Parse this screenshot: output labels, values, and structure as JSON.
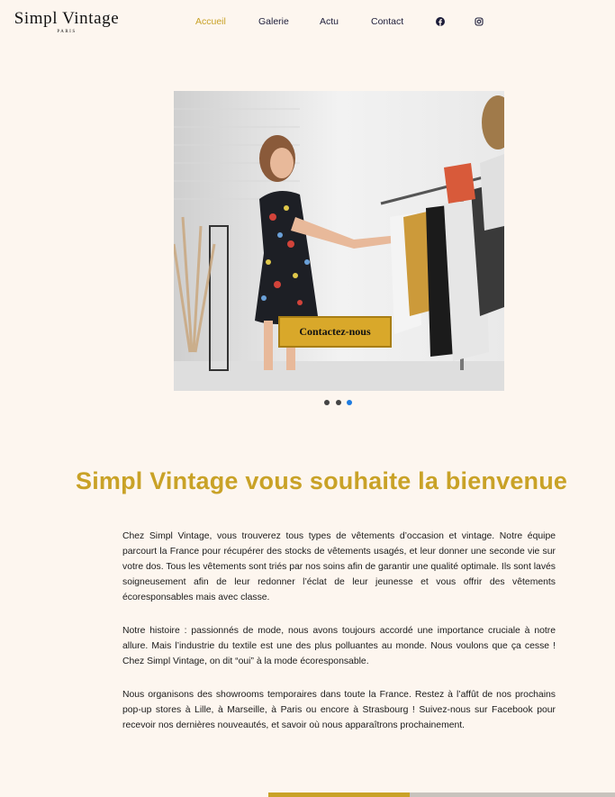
{
  "brand": {
    "name": "Simpl Vintage",
    "subtitle": "PARIS"
  },
  "nav": {
    "items": [
      {
        "label": "Accueil",
        "active": true
      },
      {
        "label": "Galerie",
        "active": false
      },
      {
        "label": "Actu",
        "active": false
      },
      {
        "label": "Contact",
        "active": false
      }
    ],
    "social": [
      "facebook-icon",
      "instagram-icon"
    ]
  },
  "hero": {
    "cta_label": "Contactez-nous",
    "slides_count": 3,
    "active_slide": 3
  },
  "main": {
    "heading": "Simpl Vintage vous souhaite la bienvenue",
    "paragraphs": [
      "Chez Simpl Vintage, vous trouverez tous types de vêtements d’occasion et vintage. Notre équipe parcourt la France pour récupérer des stocks de vêtements usagés, et leur donner une seconde vie sur votre dos. Tous les vêtements sont triés par nos soins afin de garantir une qualité optimale. Ils sont lavés soigneusement afin de leur redonner l’éclat de leur jeunesse et vous offrir des vêtements écoresponsables mais avec classe.",
      "Notre histoire : passionnés de mode, nous avons toujours accordé une importance cruciale à notre allure. Mais l’industrie du textile est une des plus polluantes au monde. Nous voulons que ça cesse ! Chez Simpl Vintage, on dit “oui” à la mode écoresponsable.",
      "Nous organisons des showrooms temporaires dans toute la France. Restez à l’affût de nos prochains pop-up stores à Lille, à Marseille, à Paris ou encore à Strasbourg ! Suivez-nous sur Facebook pour recevoir nos dernières nouveautés, et savoir où nous apparaîtrons prochainement."
    ]
  },
  "colors": {
    "accent": "#c9a227",
    "background": "#fdf6ef",
    "nav_text": "#1d1d3a",
    "dot_active": "#1e7be0"
  }
}
